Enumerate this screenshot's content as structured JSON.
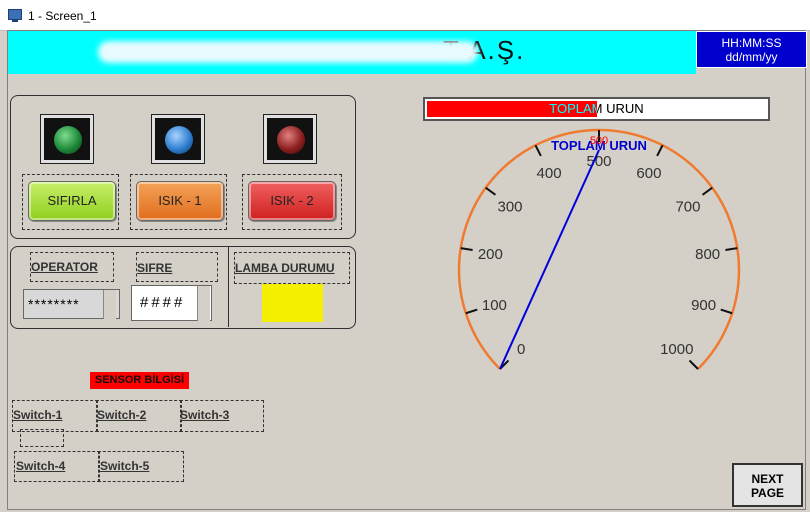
{
  "window": {
    "title": "1 - Screen_1"
  },
  "header": {
    "title_visible_suffix": "T   A.Ş.",
    "clock": {
      "time_format": "HH:MM:SS",
      "date_format": "dd/mm/yy"
    }
  },
  "lamps": [
    {
      "name": "reset-lamp",
      "color": "#1e8a3a"
    },
    {
      "name": "light1-lamp",
      "color": "#2f7fd0"
    },
    {
      "name": "light2-lamp",
      "color": "#8e1f1f"
    }
  ],
  "buttons": {
    "reset": "SIFIRLA",
    "light1": "ISIK - 1",
    "light2": "ISIK - 2",
    "next_line1": "NEXT",
    "next_line2": "PAGE"
  },
  "login": {
    "operator_label": "OPERATOR",
    "password_label": "SIFRE",
    "operator_value": "********",
    "password_value": "####",
    "lamp_status_label": "LAMBA DURUMU",
    "lamp_status_color": "#f5f000"
  },
  "sensor": {
    "title": "SENSOR BİLGİSİ",
    "switches": [
      "Switch-1",
      "Switch-2",
      "Switch-3",
      "Switch-4",
      "Switch-5"
    ]
  },
  "total_bar": {
    "label": "TOPLAM URUN",
    "value": 500,
    "max": 1000,
    "fill_color": "#ff0000"
  },
  "gauge": {
    "title": "TOPLAM URUN",
    "min": 0,
    "max": 1000,
    "value": 500,
    "value_label": "500",
    "ticks": [
      "0",
      "100",
      "200",
      "300",
      "400",
      "500",
      "600",
      "700",
      "800",
      "900",
      "1000"
    ],
    "arc_color": "#f07a30",
    "needle_color": "#0000dd"
  }
}
